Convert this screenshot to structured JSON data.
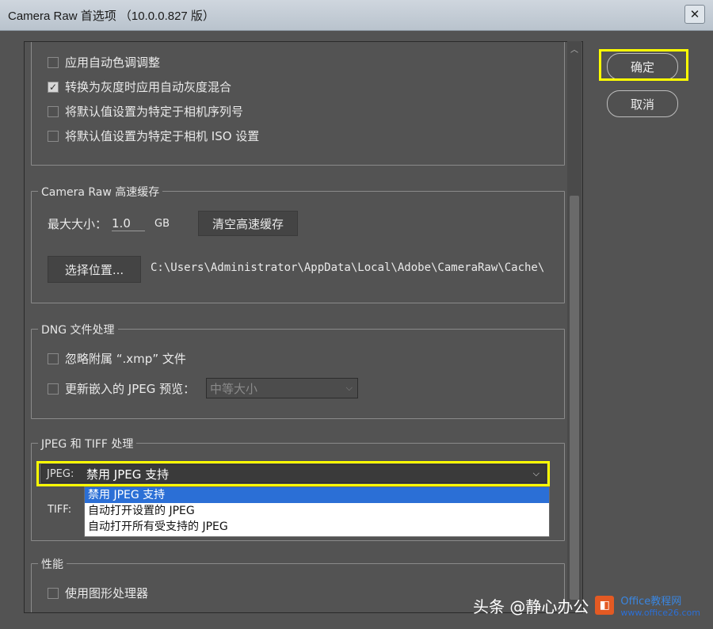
{
  "window": {
    "title": "Camera Raw 首选项 （10.0.0.827 版）"
  },
  "top_group": {
    "items": [
      {
        "label": "应用自动色调调整",
        "checked": false
      },
      {
        "label": "转换为灰度时应用自动灰度混合",
        "checked": true
      },
      {
        "label": "将默认值设置为特定于相机序列号",
        "checked": false
      },
      {
        "label": "将默认值设置为特定于相机 ISO 设置",
        "checked": false
      }
    ]
  },
  "cache": {
    "title": "Camera Raw 高速缓存",
    "max_size_label": "最大大小：",
    "max_size_value": "1.0",
    "unit": "GB",
    "purge_button": "清空高速缓存",
    "select_location_button": "选择位置...",
    "path": "C:\\Users\\Administrator\\AppData\\Local\\Adobe\\CameraRaw\\Cache\\"
  },
  "dng": {
    "title": "DNG 文件处理",
    "ignore_xmp": "忽略附属 “.xmp” 文件",
    "update_preview": "更新嵌入的 JPEG 预览：",
    "preview_size": "中等大小"
  },
  "jpeg_tiff": {
    "title": "JPEG 和 TIFF 处理",
    "jpeg_label": "JPEG:",
    "jpeg_value": "禁用 JPEG 支持",
    "tiff_label": "TIFF:",
    "options": [
      "禁用 JPEG 支持",
      "自动打开设置的 JPEG",
      "自动打开所有受支持的 JPEG"
    ]
  },
  "performance": {
    "title": "性能",
    "use_gpu": "使用图形处理器"
  },
  "buttons": {
    "ok": "确定",
    "cancel": "取消"
  },
  "watermark": {
    "text": "头条 @静心办公",
    "logo_text": "Office教程网",
    "url": "www.office26.com"
  },
  "colors": {
    "highlight": "#ffff00",
    "selection": "#2b6fd6",
    "panel": "#535353"
  }
}
